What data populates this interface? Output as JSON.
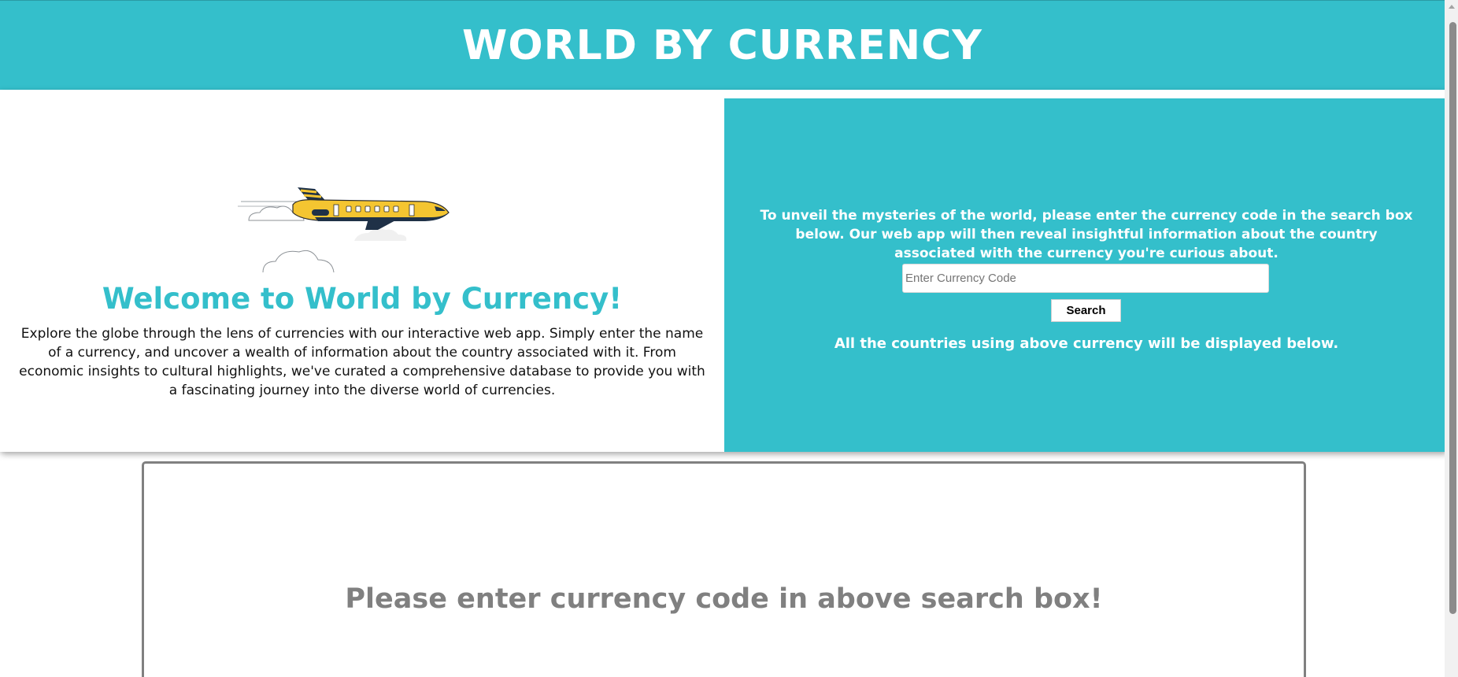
{
  "header": {
    "title": "WORLD BY CURRENCY"
  },
  "hero": {
    "illustration": "airplane-with-clouds",
    "welcome_title": "Welcome to World by Currency!",
    "welcome_text": "Explore the globe through the lens of currencies with our interactive web app. Simply enter the name of a currency, and uncover a wealth of information about the country associated with it. From economic insights to cultural highlights, we've curated a comprehensive database to provide you with a fascinating journey into the diverse world of currencies.",
    "instructions": "To unveil the mysteries of the world, please enter the currency code in the search box below. Our web app will then reveal insightful information about the country associated with the currency you're curious about.",
    "search": {
      "placeholder": "Enter Currency Code",
      "value": "",
      "button_label": "Search"
    },
    "results_note": "All the countries using above currency will be displayed below."
  },
  "results": {
    "placeholder_text": "Please enter currency code in above search box!"
  },
  "colors": {
    "accent": "#34bfcb",
    "muted_text": "#808080"
  }
}
